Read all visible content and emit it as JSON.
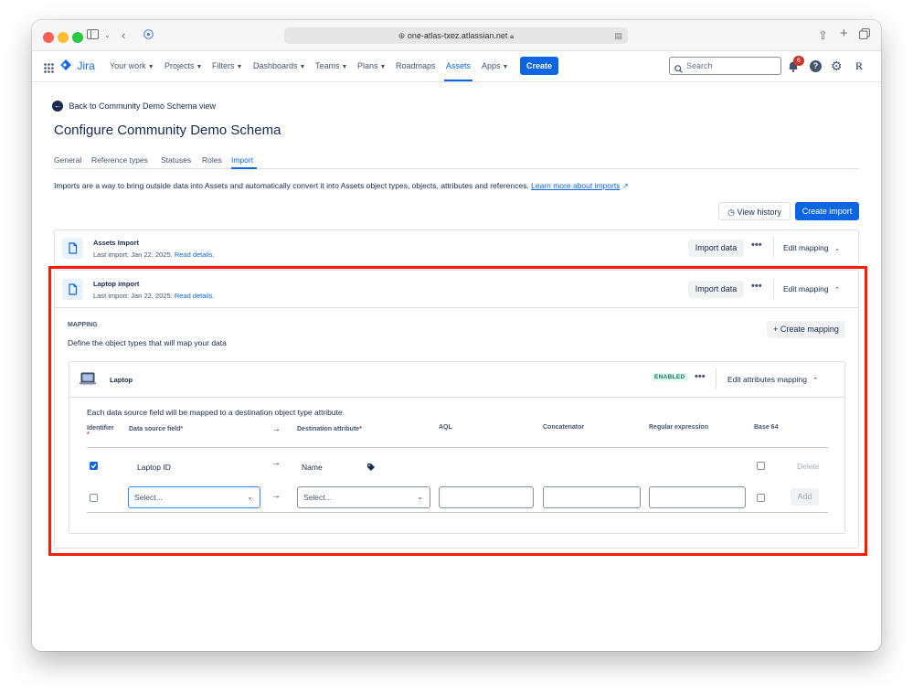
{
  "browser": {
    "url": "one-atlas-txez.atlassian.net",
    "lock_icon": "lock-icon"
  },
  "nav": {
    "product": "Jira",
    "items": [
      {
        "label": "Your work"
      },
      {
        "label": "Projects"
      },
      {
        "label": "Filters"
      },
      {
        "label": "Dashboards"
      },
      {
        "label": "Teams"
      },
      {
        "label": "Plans"
      },
      {
        "label": "Roadmaps"
      },
      {
        "label": "Assets"
      },
      {
        "label": "Apps"
      }
    ],
    "create_label": "Create",
    "search_placeholder": "Search",
    "notification_count": "6",
    "profile_initial": "R"
  },
  "page": {
    "back_link": "Back to Community Demo Schema view",
    "title": "Configure Community Demo Schema",
    "tabs": [
      "General",
      "Reference types",
      "Statuses",
      "Roles",
      "Import"
    ],
    "active_tab": "Import",
    "description": "Imports are a way to bring outside data into Assets and automatically convert it into Assets object types, objects, attributes and references.",
    "learn_more": "Learn more about imports",
    "view_history": "View history",
    "create_import": "Create import"
  },
  "imports": [
    {
      "name": "Assets Import",
      "last_import": "Last import: Jan 22, 2025.",
      "read_details": "Read details.",
      "import_data": "Import data",
      "edit_mapping": "Edit mapping"
    },
    {
      "name": "Laptop import",
      "last_import": "Last import: Jan 22, 2025.",
      "read_details": "Read details.",
      "import_data": "Import data",
      "edit_mapping": "Edit mapping"
    }
  ],
  "mapping": {
    "heading": "MAPPING",
    "subheading": "Define the object types that will map your data",
    "create_mapping": "+ Create mapping",
    "object_type": "Laptop",
    "status": "ENABLED",
    "edit_attributes": "Edit attributes mapping",
    "info": "Each data source field will be mapped to a destination object type attribute.",
    "columns": {
      "identifier": "Identifier",
      "source": "Data source field",
      "destination": "Destination attribute",
      "aql": "AQL",
      "concatenator": "Concatenator",
      "regex": "Regular expression",
      "base64": "Base 64"
    },
    "required_mark": "*",
    "row": {
      "source": "Laptop ID",
      "destination": "Name",
      "identifier_checked": true,
      "delete": "Delete"
    },
    "new_row": {
      "source_placeholder": "Select...",
      "destination_placeholder": "Select...",
      "add": "Add"
    }
  },
  "colors": {
    "accent": "#0c66e4",
    "highlight_box": "#ff1a00",
    "enabled_text": "#216e4e",
    "badge_red": "#c9372c"
  }
}
